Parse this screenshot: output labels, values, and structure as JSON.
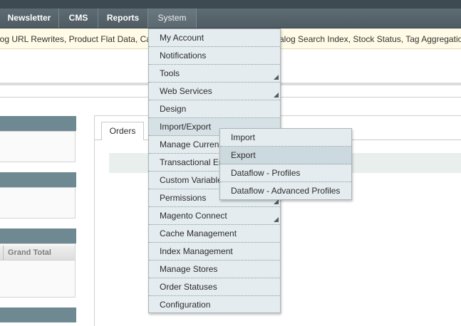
{
  "nav": {
    "items": [
      {
        "label": "Newsletter"
      },
      {
        "label": "CMS"
      },
      {
        "label": "Reports"
      },
      {
        "label": "System"
      }
    ]
  },
  "notice": {
    "text_left": "log URL Rewrites, Product Flat Data, Categ",
    "text_right": "alog Search Index, Stock Status, Tag Aggregation D"
  },
  "dashboard": {
    "grid_header": "Grand Total"
  },
  "content": {
    "tab_label": "Orders"
  },
  "system_menu": {
    "items": [
      {
        "label": "My Account"
      },
      {
        "label": "Notifications"
      },
      {
        "label": "Tools"
      },
      {
        "label": "Web Services"
      },
      {
        "label": "Design"
      },
      {
        "label": "Import/Export"
      },
      {
        "label": "Manage Currency"
      },
      {
        "label": "Transactional Emails"
      },
      {
        "label": "Custom Variables"
      },
      {
        "label": "Permissions"
      },
      {
        "label": "Magento Connect"
      },
      {
        "label": "Cache Management"
      },
      {
        "label": "Index Management"
      },
      {
        "label": "Manage Stores"
      },
      {
        "label": "Order Statuses"
      },
      {
        "label": "Configuration"
      }
    ]
  },
  "import_export_menu": {
    "items": [
      {
        "label": "Import"
      },
      {
        "label": "Export"
      },
      {
        "label": "Dataflow - Profiles"
      },
      {
        "label": "Dataflow - Advanced Profiles"
      }
    ]
  }
}
